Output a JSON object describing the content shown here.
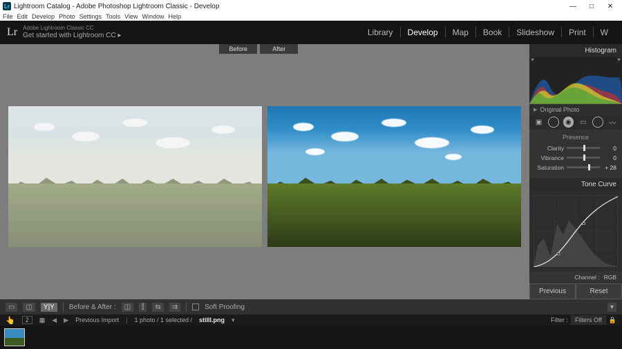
{
  "window": {
    "title": "Lightroom Catalog - Adobe Photoshop Lightroom Classic - Develop"
  },
  "menu": [
    "File",
    "Edit",
    "Develop",
    "Photo",
    "Settings",
    "Tools",
    "View",
    "Window",
    "Help"
  ],
  "branding": {
    "logo": "Lr",
    "line1": "Adobe Lightroom Classic CC",
    "line2": "Get started with Lightroom CC  ▸"
  },
  "modules": {
    "items": [
      "Library",
      "Develop",
      "Map",
      "Book",
      "Slideshow",
      "Print",
      "W"
    ],
    "active": 1
  },
  "before_after": {
    "before_label": "Before",
    "after_label": "After",
    "toolbar_label": "Before & After :",
    "soft_proof": "Soft Proofing"
  },
  "right_panel": {
    "histogram_label": "Histogram",
    "original_photo": "Original Photo",
    "presence": {
      "title": "Presence",
      "sliders": [
        {
          "label": "Clarity",
          "value": "0",
          "pos": 50
        },
        {
          "label": "Vibrance",
          "value": "0",
          "pos": 50
        },
        {
          "label": "Saturation",
          "value": "+ 28",
          "pos": 64
        }
      ]
    },
    "tone_curve_label": "Tone Curve",
    "channel_label": "Channel :",
    "channel_value": "RGB",
    "previous": "Previous",
    "reset": "Reset"
  },
  "filmstrip": {
    "count_box": "2",
    "source": "Previous Import",
    "selection": "1 photo / 1 selected /",
    "filename": "stilll.png",
    "filter_label": "Filter :",
    "filters_off": "Filters Off"
  }
}
